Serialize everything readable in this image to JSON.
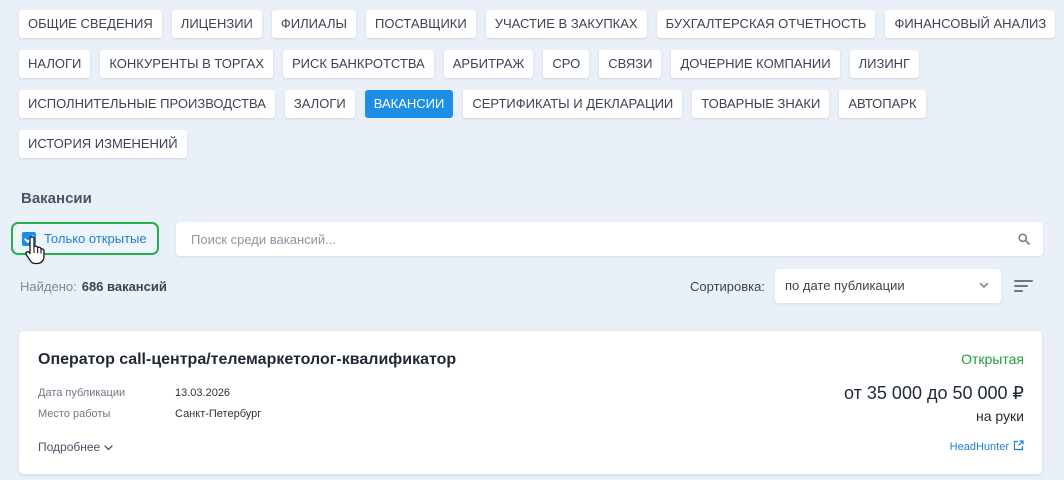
{
  "tabs": {
    "row1": [
      "ОБЩИЕ СВЕДЕНИЯ",
      "ЛИЦЕНЗИИ",
      "ФИЛИАЛЫ",
      "ПОСТАВЩИКИ",
      "УЧАСТИЕ В ЗАКУПКАХ",
      "БУХГАЛТЕРСКАЯ ОТЧЕТНОСТЬ",
      "ФИНАНСОВЫЙ АНАЛИЗ"
    ],
    "row2": [
      "НАЛОГИ",
      "КОНКУРЕНТЫ В ТОРГАХ",
      "РИСК БАНКРОТСТВА",
      "АРБИТРАЖ",
      "СРО",
      "СВЯЗИ",
      "ДОЧЕРНИЕ КОМПАНИИ",
      "ЛИЗИНГ"
    ],
    "row3": [
      "ИСПОЛНИТЕЛЬНЫЕ ПРОИЗВОДСТВА",
      "ЗАЛОГИ",
      "ВАКАНСИИ",
      "СЕРТИФИКАТЫ И ДЕКЛАРАЦИИ",
      "ТОВАРНЫЕ ЗНАКИ",
      "АВТОПАРК"
    ],
    "row4": [
      "ИСТОРИЯ ИЗМЕНЕНИЙ"
    ],
    "active": "ВАКАНСИИ"
  },
  "section_title": "Вакансии",
  "filter": {
    "only_open_label": "Только открытые",
    "only_open_checked": true
  },
  "search": {
    "placeholder": "Поиск среди вакансий...",
    "value": ""
  },
  "results": {
    "found_label": "Найдено:",
    "found_count": "686 вакансий"
  },
  "sort": {
    "label": "Сортировка:",
    "selected": "по дате публикации"
  },
  "vacancy": {
    "title": "Оператор call-центра/телемаркетолог-квалификатор",
    "status": "Открытая",
    "date_label": "Дата публикации",
    "date_value": "13.03.2026",
    "place_label": "Место работы",
    "place_value": "Санкт-Петербург",
    "salary": "от 35 000 до 50 000 ₽",
    "salary_note": "на руки",
    "more_label": "Подробнее",
    "source": "HeadHunter"
  },
  "colors": {
    "accent": "#1c8ee6",
    "status_open": "#22a03c",
    "highlight": "#22b14c",
    "background": "#e9f0f8"
  },
  "icons": [
    "check-icon",
    "hand-cursor-icon",
    "search-icon",
    "chevron-down-icon",
    "sort-icon",
    "external-link-icon"
  ]
}
